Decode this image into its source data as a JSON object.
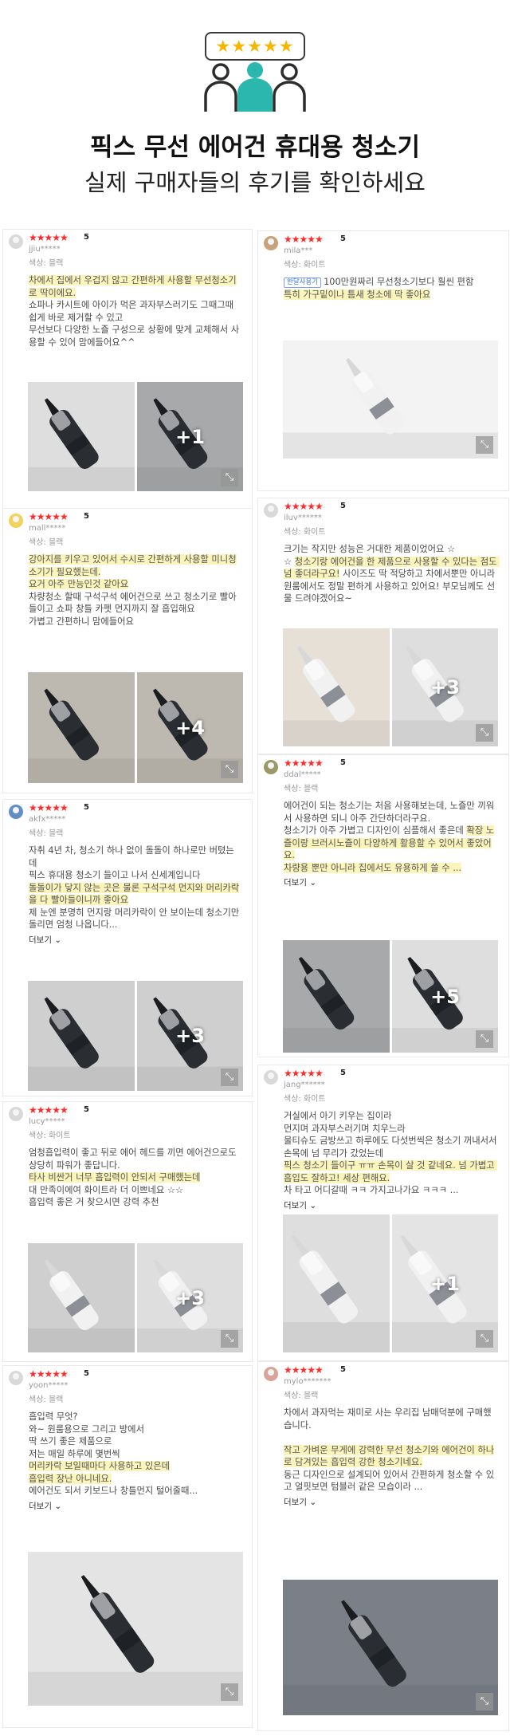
{
  "hero": {
    "stars": "★★★★★",
    "title": "픽스 무선 에어건 휴대용 청소기",
    "subtitle": "실제 구매자들의 후기를 확인하세요"
  },
  "colors": {
    "star": "#ff2b2b",
    "highlight": "#fbf4bb",
    "hero_star": "#f6b600",
    "people_center": "#2bb7ad"
  },
  "reviews": [
    {
      "stars": "★★★★★",
      "score": "5",
      "user": "jjiu*****",
      "option": "색상: 블랙",
      "text": [
        {
          "h": true,
          "t": "차에서 집에서 우겁지 않고 간편하게 사용할 무선청소기로 딱이에요."
        },
        {
          "h": false,
          "t": "\n쇼파나 카시트에 아이가 먹은 과자부스러기도 그때그때 쉽게 바로 제거할 수 있고\n무선보다 다양한 노즐 구성으로 상황에 맞게 교체해서 사용할 수 있어 맘에들어요^^"
        }
      ],
      "more": "",
      "photo_count": "+1"
    },
    {
      "stars": "★★★★★",
      "score": "5",
      "user": "mila***",
      "option": "색상: 화이트",
      "tag": "한달사용기",
      "text": [
        {
          "h": false,
          "t": "100만원짜리 무선청소기보다 훨씬 편함\n"
        },
        {
          "h": true,
          "t": "특히 가구밑이나 틈새 청소에 딱 좋아요"
        }
      ],
      "more": "",
      "photo_count": ""
    },
    {
      "stars": "★★★★★",
      "score": "5",
      "user": "mall*****",
      "option": "색상: 블랙",
      "text": [
        {
          "h": true,
          "t": "강아지를 키우고 있어서 수시로 간편하게 사용할 미니청소기가 필요했는데.\n요거 아주 만능인것 같아요"
        },
        {
          "h": false,
          "t": "\n차량청소 할때 구석구석 에어건으로 쓰고 청소기로 빨아들이고 쇼파 창틀 카펫 먼지까지 잘 흡입해요\n가볍고 간편하니 맘에들어요"
        }
      ],
      "more": "",
      "photo_count": "+4"
    },
    {
      "stars": "★★★★★",
      "score": "5",
      "user": "iluv******",
      "option": "색상: 화이트",
      "text": [
        {
          "h": false,
          "t": "크기는 작지만 성능은 거대한 제품이었어요 ☆\n☆ "
        },
        {
          "h": true,
          "t": "청소기랑 에어건을 한 제품으로 사용할 수 있다는 점도 넘 좋더라구요!"
        },
        {
          "h": false,
          "t": " 사이즈도 딱 적당하고 차에서뿐만 아니라 원룸에서도 정말 편하게 사용하고 있어요! 부모님께도 선물 드려야겠어요~"
        }
      ],
      "more": "",
      "photo_count": "+3"
    },
    {
      "stars": "★★★★★",
      "score": "5",
      "user": "akfx*****",
      "option": "색상: 블랙",
      "text": [
        {
          "h": false,
          "t": "자취 4년 차, 청소기 하나 없이 돌돌이 하나로만 버텼는데\n픽스 휴대용 청소기 들이고 나서 신세계입니다\n"
        },
        {
          "h": true,
          "t": "돌돌이가 닿지 않는 곳은 물론 구석구석 먼지와 머리카락을 다 빨아들이니까 좋아요"
        },
        {
          "h": false,
          "t": "\n제 눈엔 분명히 먼지랑 머리카락이 안 보이는데 청소기만 돌리면 엄청 나옵니다..."
        }
      ],
      "more": "더보기",
      "photo_count": "+3"
    },
    {
      "stars": "★★★★★",
      "score": "5",
      "user": "ddal*****",
      "option": "색상: 블랙",
      "text": [
        {
          "h": false,
          "t": "에어건이 되는 청소기는 처음 사용해보는데, 노즐만 끼워서 사용하면 되니 아주 간단하더라구요.\n청소기가 아주 가볍고 디자인이 심플해서 좋은데 "
        },
        {
          "h": true,
          "t": "확장 노즐이랑 브러시노즐이 다양하게 활용할 수 있어서 좋았어요.\n차량용 뿐만 아니라 집에서도 유용하게 쓸 수 ..."
        }
      ],
      "more": "더보기",
      "photo_count": "+5"
    },
    {
      "stars": "★★★★★",
      "score": "5",
      "user": "lucy*****",
      "option": "색상: 화이트",
      "text": [
        {
          "h": false,
          "t": "엄청흡입력이 좋고 뒤로 에어 헤드를 끼면 에어건으로도 상당히 파워가 좋답니다.\n"
        },
        {
          "h": true,
          "t": "타사 비싼거 너무 흡입력이 안되서 구매했는데"
        },
        {
          "h": false,
          "t": "\n대 만족이에여 화이트라 더 이쁘네요 ☆☆\n흡입력 좋은 거 찾으시면 강력 추천"
        }
      ],
      "more": "",
      "photo_count": "+3"
    },
    {
      "stars": "★★★★★",
      "score": "5",
      "user": "jang******",
      "option": "색상: 화이트",
      "text": [
        {
          "h": false,
          "t": "거실에서 아기 키우는 집이라\n먼지며 과자부스러기며 치우느라\n물티슈도 금방쓰고 하루에도 다섯번씩은 청소기 꺼내서서 손목에 넘 무리가 갔었는데\n"
        },
        {
          "h": true,
          "t": "픽스 청소기 들이구 ㅠㅠ 손목이 살 것 같네요. 넘 가볍고 흡입도 잘하고! 세상 편해요."
        },
        {
          "h": false,
          "t": "\n차 타고 어디갈때 ㅋㅋ 가지고나가요 ㅋㅋㅋ ..."
        }
      ],
      "more": "더보기",
      "photo_count": "+1"
    },
    {
      "stars": "★★★★★",
      "score": "5",
      "user": "yoon*****",
      "option": "색상: 블랙",
      "text": [
        {
          "h": false,
          "t": "흡입력 무엇?\n와~ 원룸용으로 그리고 방에서\n딱 쓰기 좋은 제품으로\n저는 매일 하루에 몇번씩\n"
        },
        {
          "h": true,
          "t": "머리카락 보일때마다 사용하고 있은데\n흡입력 장난 아니네요."
        },
        {
          "h": false,
          "t": "\n에어건도 되서 키보드나 창틀먼지 털어줄때..."
        }
      ],
      "more": "더보기",
      "photo_count": ""
    },
    {
      "stars": "★★★★★",
      "score": "5",
      "user": "mylo*******",
      "option": "색상: 블랙",
      "text": [
        {
          "h": false,
          "t": "차에서 과자먹는 재미로 사는 우리집 남매덕분에 구매했습니다.\n\n"
        },
        {
          "h": true,
          "t": "작고 가벼운 무게에 강력한 무선 청소기와 에어건이 하나로 담겨있는 흡입력 강한 청소기네요."
        },
        {
          "h": false,
          "t": "\n동근 디자인으로 설계되어 있어서 간편하게 청소할 수 있고 얼핏보면 텀블러 같은 모습이라 ..."
        }
      ],
      "more": "더보기",
      "photo_count": ""
    }
  ]
}
